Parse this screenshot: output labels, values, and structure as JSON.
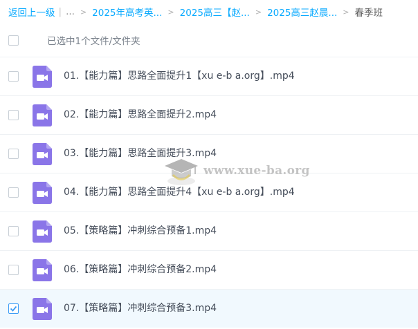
{
  "breadcrumb": {
    "back_label": "返回上一级",
    "ellipsis": "...",
    "crumbs": [
      "2025年高考英...",
      "2025高三【赵...",
      "2025高三赵晨..."
    ],
    "current": "春季班"
  },
  "selection": {
    "status_text": "已选中1个文件/文件夹"
  },
  "files": [
    {
      "name": "01.【能力篇】思路全面提升1【xu e-b a.org】.mp4",
      "checked": false
    },
    {
      "name": "02.【能力篇】思路全面提升2.mp4",
      "checked": false
    },
    {
      "name": "03.【能力篇】思路全面提升3.mp4",
      "checked": false
    },
    {
      "name": "04.【能力篇】思路全面提升4【xu e-b a.org】.mp4",
      "checked": false
    },
    {
      "name": "05.【策略篇】冲刺综合预备1.mp4",
      "checked": false
    },
    {
      "name": "06.【策略篇】冲刺综合预备2.mp4",
      "checked": false
    },
    {
      "name": "07.【策略篇】冲刺综合预备3.mp4",
      "checked": true
    }
  ],
  "watermark": {
    "text": "www.xue-ba.org",
    "icon": "graduation-cap-logo"
  },
  "colors": {
    "link": "#09aaff",
    "video_icon": "#8a75e8",
    "selected_row": "#f1f9fe",
    "checkbox_checked": "#3d9df5"
  },
  "icons": {
    "file": "video-file-icon",
    "check": "check-icon"
  }
}
